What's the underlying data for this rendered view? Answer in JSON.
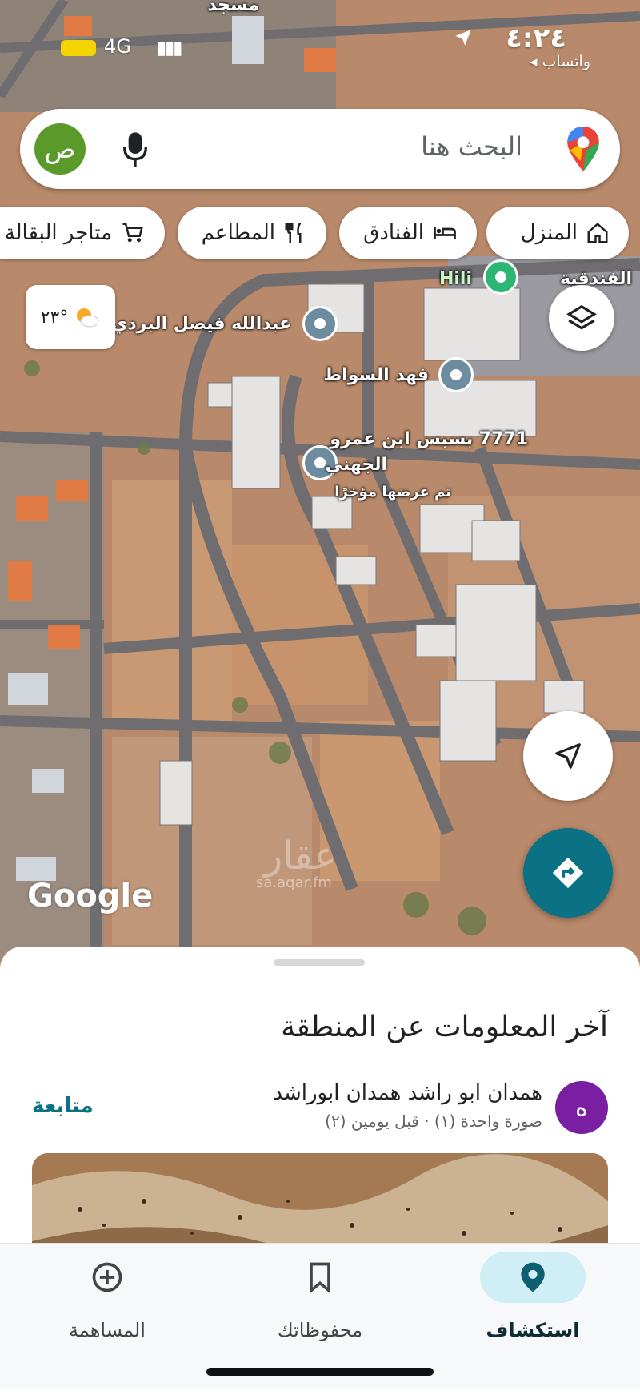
{
  "status_bar": {
    "time": "٤:٢٤",
    "back_app": "◂ واتساب",
    "network": "4G",
    "battery_color": "#f3d400"
  },
  "search": {
    "placeholder": "البحث هنا",
    "avatar_letter": "ص",
    "icons": [
      "google-maps-pin-icon",
      "microphone-icon"
    ]
  },
  "chips": [
    {
      "label": "المنزل",
      "icon": "home-icon"
    },
    {
      "label": "الفنادق",
      "icon": "bed-icon"
    },
    {
      "label": "المطاعم",
      "icon": "fork-knife-icon"
    },
    {
      "label": "متاجر البقالة",
      "icon": "cart-icon"
    }
  ],
  "weather": {
    "temp": "٢٣°",
    "icon": "partly-cloudy-icon"
  },
  "map": {
    "labels": [
      {
        "text": "عبدالله فيصل البردي"
      },
      {
        "text": "فهد السواط"
      },
      {
        "text": "7771 بسبس ابن عمرو"
      },
      {
        "text": "الجهني"
      },
      {
        "text": "تم عرضها مؤخرًا"
      },
      {
        "text": "مسجد"
      },
      {
        "text": "Hili"
      },
      {
        "text": "الفندقية"
      }
    ],
    "watermark": "sa.aqar.fm",
    "watermark_logo": "عقار",
    "attribution": "Google",
    "colors": {
      "accent": "#0b7285"
    }
  },
  "sheet": {
    "title": "آخر المعلومات عن المنطقة",
    "post": {
      "avatar_letter": "ه",
      "author": "همدان ابو راشد همدان ابوراشد",
      "meta": "صورة واحدة (١) · قبل يومين (٢)",
      "follow_label": "متابعة"
    }
  },
  "bottom_nav": {
    "items": [
      {
        "label": "استكشاف",
        "icon": "location-pin-icon",
        "active": true
      },
      {
        "label": "محفوظاتك",
        "icon": "bookmark-icon",
        "active": false
      },
      {
        "label": "المساهمة",
        "icon": "add-circle-icon",
        "active": false
      }
    ]
  }
}
